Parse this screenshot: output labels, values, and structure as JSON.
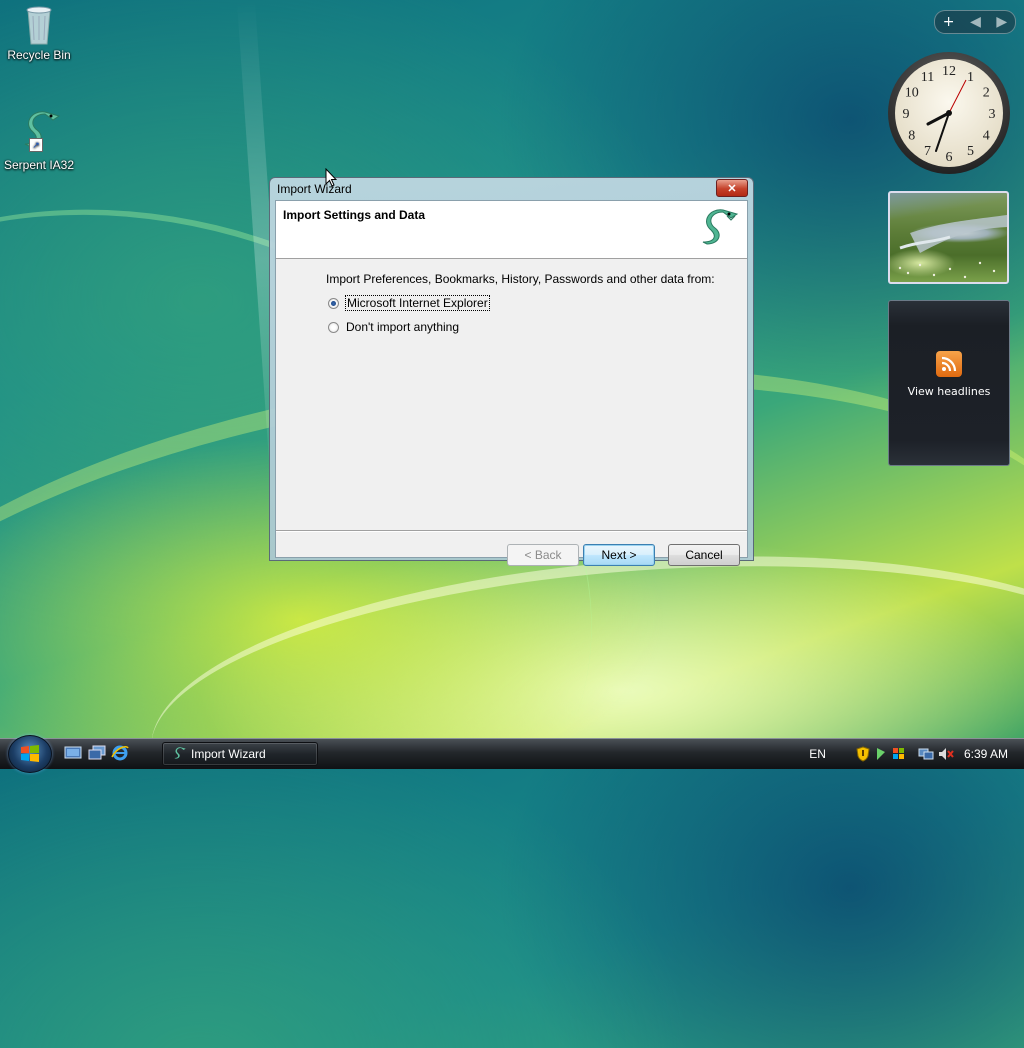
{
  "desktop": {
    "icons": [
      {
        "label": "Recycle Bin"
      },
      {
        "label": "Serpent IA32"
      }
    ]
  },
  "gadgets": {
    "clock": {
      "numerals": [
        "12",
        "1",
        "2",
        "3",
        "4",
        "5",
        "6",
        "7",
        "8",
        "9",
        "10",
        "11"
      ],
      "time": "6:39"
    },
    "feed": {
      "label": "View headlines"
    }
  },
  "dialog": {
    "title": "Import Wizard",
    "header_title": "Import Settings and Data",
    "prompt": "Import Preferences, Bookmarks, History, Passwords and other data from:",
    "options": [
      {
        "label": "Microsoft Internet Explorer",
        "selected": true
      },
      {
        "label": "Don't import anything",
        "selected": false
      }
    ],
    "buttons": {
      "back": "< Back",
      "next": "Next >",
      "cancel": "Cancel"
    }
  },
  "taskbar": {
    "task_label": "Import Wizard",
    "language": "EN",
    "clock": "6:39 AM"
  },
  "colors": {
    "accent": "#3c7fb1",
    "close": "#c5412a"
  }
}
